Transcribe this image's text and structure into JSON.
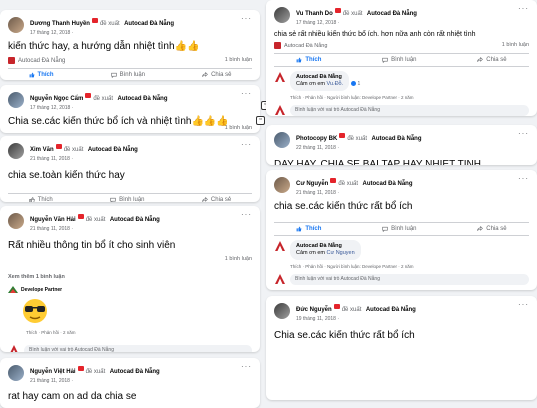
{
  "common": {
    "suggested": "đề xuất",
    "page_name": "Autocad Đà Nẵng",
    "like": "Thích",
    "comment": "Bình luận",
    "share": "Chia sẻ",
    "one_comment": "1 bình luận",
    "comment_as": "Bình luận với vai trò Autocad Đà Nẵng",
    "reply_meta": "Thích · Phản hồi · Người bình luận: Develope Partner · 2 năm",
    "dots": "···"
  },
  "posts_left": [
    {
      "name": "Dương Thanh Huyền",
      "date": "17 tháng 12, 2018 ·",
      "text": "kiến thức hay, a hướng dẫn nhiệt tình👍👍"
    },
    {
      "name": "Nguyễn Ngọc Cẩm",
      "date": "17 tháng 12, 2018 ·",
      "text": "Chia se.các kiến thức bổ ích và nhiệt tình👍👍👍"
    },
    {
      "name": "Xim Văn",
      "date": "21 tháng 11, 2018 ·",
      "text": "chia se.toàn kiến thức hay"
    },
    {
      "name": "Nguyễn Văn Hải",
      "date": "21 tháng 11, 2018 ·",
      "text": "Rất nhiều thông tin bổ ít cho sinh viên"
    },
    {
      "name": "Nguyễn Việt Hải",
      "date": "21 tháng 11, 2018 ·",
      "text": "rat hay cam on ad da chia se"
    }
  ],
  "more_comments": "Xem thêm 1 bình luận",
  "develope": {
    "name": "Develope Partner",
    "meta": "Thích · Phản hồi · 2 năm"
  },
  "posts_right": [
    {
      "name": "Vu Thanh Do",
      "date": "17 tháng 12, 2018 ·",
      "text": "chia sẻ rất nhiều kiến thức bổ ích. hơn nữa anh còn rất nhiệt tình",
      "reply_name": "Autocad Đà Nẵng",
      "reply_text": "Cảm ơn em",
      "reply_tag": "Vu.Đỗ.",
      "reply_count": "1"
    },
    {
      "name": "Photocopy BK",
      "date": "22 tháng 11, 2018 ·",
      "text": "DAY HAY, CHIA SE BAI TAP HAY NHIET TINH"
    },
    {
      "name": "Cư Nguyễn",
      "date": "21 tháng 11, 2018 ·",
      "text": "chia se.các kiến thức rất bổ ích",
      "reply_name": "Autocad Đà Nẵng",
      "reply_text": "Cảm ơn em",
      "reply_tag": "Cư Nguyen"
    },
    {
      "name": "Đức Nguyễn",
      "date": "19 tháng 11, 2018 ·",
      "text": "Chia se.các kiến thức rất bổ ích"
    }
  ]
}
